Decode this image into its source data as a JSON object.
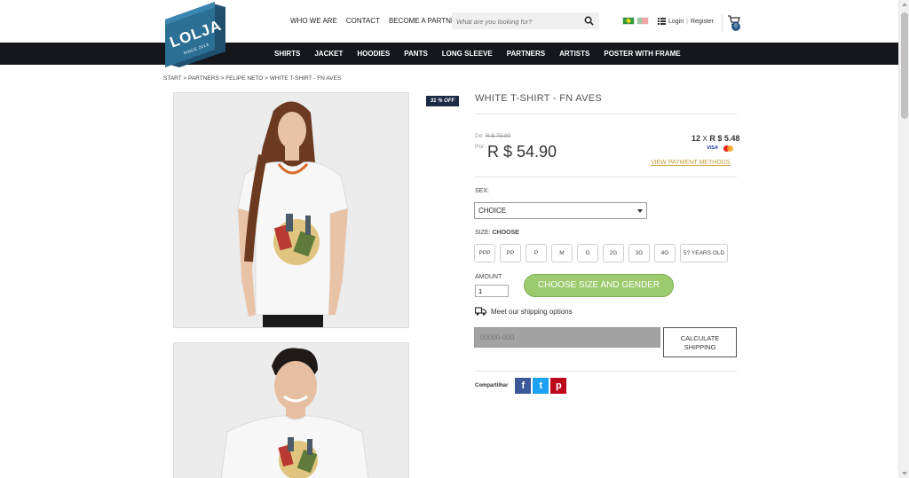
{
  "header": {
    "logo_text": "LOLJA",
    "logo_subtext": "SINCE 2013",
    "top_links": [
      "WHO WE ARE",
      "CONTACT",
      "BECOME A PARTNER"
    ],
    "search_placeholder": "What are you looking for?",
    "login_label": "Login",
    "login_separator": "|",
    "register_label": "Register",
    "cart_count": "0"
  },
  "nav": {
    "items": [
      "SHIRTS",
      "JACKET",
      "HOODIES",
      "PANTS",
      "LONG SLEEVE",
      "PARTNERS",
      "ARTISTS",
      "POSTER WITH FRAME"
    ]
  },
  "breadcrumb": "START > PARTNERS > FELIPE NETO > WHITE T-SHIRT - FN AVES",
  "product": {
    "discount_badge": "31 % OFF",
    "title": "WHITE T-SHIRT - FN AVES",
    "price_old_prefix": "De:",
    "price_old": "R $ 79.90",
    "price_new_prefix": "Por:",
    "price_new": "R $ 54.90",
    "installments_count": "12",
    "installments_x": "X",
    "installments_value": "R $ 5.48",
    "card_visa": "VISA",
    "view_payment_methods": "VIEW PAYMENT METHODS",
    "sex_label": "SEX:",
    "sex_selected": "CHOICE",
    "size_label": "SIZE:",
    "size_value": "CHOOSE",
    "sizes": [
      "PPP",
      "PP",
      "P",
      "M",
      "G",
      "2G",
      "3G",
      "4G",
      "5? YEARS OLD"
    ],
    "amount_label": "AMOUNT",
    "amount_value": "1",
    "choose_button": "CHOOSE SIZE AND GENDER",
    "shipping_text": "Meet our shipping options",
    "zip_placeholder": "00000-000",
    "calculate_button_line1": "CALCULATE",
    "calculate_button_line2": "SHIPPING",
    "share_label": "Compartilhar",
    "share_facebook": "f",
    "share_twitter": "t",
    "share_pinterest": "p"
  },
  "colors": {
    "nav_bg": "#14171b",
    "logo_blue": "#2b6f95",
    "choose_button": "#9ccb6e",
    "payment_link": "#c6a23a",
    "badge": "#1d2a44"
  }
}
